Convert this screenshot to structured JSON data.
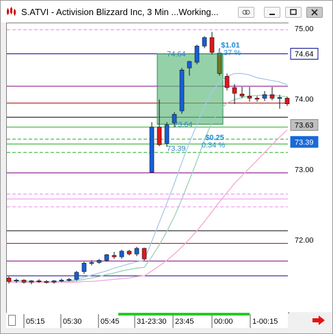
{
  "window": {
    "title": "S.ATVI - Activision Blizzard Inc, 3 Min ...Working...",
    "buttons": [
      "link-icon",
      "minimize-icon",
      "restore-icon",
      "close-icon"
    ]
  },
  "chart_data": {
    "type": "candlestick",
    "title": "",
    "ylim": [
      71.3,
      75.1
    ],
    "y_ticks": [
      75.0,
      74.0,
      73.0,
      72.0
    ],
    "y_tick_labels": [
      "75.00",
      "74.00",
      "73.00",
      "72.00"
    ],
    "x_tick_labels": [
      "05:15",
      "05:30",
      "05:45",
      "31-23:30",
      "23:45",
      "00:00",
      "1-00:15"
    ],
    "price_badges": [
      {
        "value": 74.64,
        "label": "74.64",
        "style": "outline"
      },
      {
        "value": 73.63,
        "label": "73.63",
        "style": "gray"
      },
      {
        "value": 73.39,
        "label": "73.39",
        "style": "blue"
      }
    ],
    "candles": [
      {
        "o": 71.46,
        "h": 71.48,
        "l": 71.38,
        "c": 71.41
      },
      {
        "o": 71.42,
        "h": 71.45,
        "l": 71.39,
        "c": 71.43
      },
      {
        "o": 71.43,
        "h": 71.44,
        "l": 71.38,
        "c": 71.4
      },
      {
        "o": 71.4,
        "h": 71.43,
        "l": 71.37,
        "c": 71.42
      },
      {
        "o": 71.42,
        "h": 71.44,
        "l": 71.39,
        "c": 71.41
      },
      {
        "o": 71.41,
        "h": 71.43,
        "l": 71.38,
        "c": 71.4
      },
      {
        "o": 71.4,
        "h": 71.43,
        "l": 71.38,
        "c": 71.42
      },
      {
        "o": 71.42,
        "h": 71.45,
        "l": 71.4,
        "c": 71.43
      },
      {
        "o": 71.43,
        "h": 71.46,
        "l": 71.41,
        "c": 71.44
      },
      {
        "o": 71.44,
        "h": 71.56,
        "l": 71.42,
        "c": 71.54
      },
      {
        "o": 71.55,
        "h": 71.69,
        "l": 71.52,
        "c": 71.67
      },
      {
        "o": 71.67,
        "h": 71.71,
        "l": 71.64,
        "c": 71.68
      },
      {
        "o": 71.68,
        "h": 71.73,
        "l": 71.66,
        "c": 71.71
      },
      {
        "o": 71.71,
        "h": 71.8,
        "l": 71.69,
        "c": 71.79
      },
      {
        "o": 71.78,
        "h": 71.83,
        "l": 71.73,
        "c": 71.76
      },
      {
        "o": 71.76,
        "h": 71.86,
        "l": 71.73,
        "c": 71.84
      },
      {
        "o": 71.84,
        "h": 71.86,
        "l": 71.78,
        "c": 71.8
      },
      {
        "o": 71.8,
        "h": 71.9,
        "l": 71.77,
        "c": 71.88
      },
      {
        "o": 71.88,
        "h": 71.89,
        "l": 71.71,
        "c": 71.73
      },
      {
        "o": 72.96,
        "h": 73.67,
        "l": 72.96,
        "c": 73.6
      },
      {
        "o": 73.6,
        "h": 73.99,
        "l": 73.33,
        "c": 73.35
      },
      {
        "o": 73.37,
        "h": 73.67,
        "l": 73.32,
        "c": 73.63
      },
      {
        "o": 73.66,
        "h": 73.81,
        "l": 73.6,
        "c": 73.78
      },
      {
        "o": 73.83,
        "h": 74.44,
        "l": 73.79,
        "c": 74.41
      },
      {
        "o": 74.44,
        "h": 74.54,
        "l": 74.33,
        "c": 74.53
      },
      {
        "o": 74.52,
        "h": 74.77,
        "l": 74.49,
        "c": 74.75
      },
      {
        "o": 74.75,
        "h": 74.89,
        "l": 74.72,
        "c": 74.87
      },
      {
        "o": 74.87,
        "h": 74.95,
        "l": 74.63,
        "c": 74.66
      },
      {
        "o": 74.65,
        "h": 74.72,
        "l": 74.33,
        "c": 74.36
      },
      {
        "o": 74.32,
        "h": 74.36,
        "l": 74.12,
        "c": 74.16
      },
      {
        "o": 74.16,
        "h": 74.21,
        "l": 73.93,
        "c": 74.08
      },
      {
        "o": 74.07,
        "h": 74.17,
        "l": 74.01,
        "c": 74.04
      },
      {
        "o": 74.04,
        "h": 74.17,
        "l": 73.96,
        "c": 74.01
      },
      {
        "o": 74.01,
        "h": 74.04,
        "l": 73.96,
        "c": 74.0
      },
      {
        "o": 74.01,
        "h": 74.11,
        "l": 73.97,
        "c": 74.06
      },
      {
        "o": 74.06,
        "h": 74.17,
        "l": 73.98,
        "c": 74.01
      },
      {
        "o": 74.01,
        "h": 74.06,
        "l": 73.86,
        "c": 74.02
      },
      {
        "o": 74.01,
        "h": 74.03,
        "l": 73.9,
        "c": 73.93
      }
    ],
    "horizontal_lines": [
      {
        "value": 74.98,
        "color": "#ee88ee",
        "style": "dashed"
      },
      {
        "value": 74.64,
        "color": "#00008b",
        "style": "solid"
      },
      {
        "value": 74.18,
        "color": "#800080",
        "style": "solid"
      },
      {
        "value": 73.94,
        "color": "#aa0000",
        "style": "solid"
      },
      {
        "value": 73.74,
        "color": "#000000",
        "style": "solid"
      },
      {
        "value": 73.6,
        "color": "#22aa22",
        "style": "solid"
      },
      {
        "value": 73.43,
        "color": "#22aa22",
        "style": "dashed"
      },
      {
        "value": 73.36,
        "color": "#22aa22",
        "style": "solid"
      },
      {
        "value": 73.24,
        "color": "#22aa22",
        "style": "dashed"
      },
      {
        "value": 72.95,
        "color": "#800080",
        "style": "solid"
      },
      {
        "value": 72.65,
        "color": "#ee88ee",
        "style": "dashed"
      },
      {
        "value": 72.58,
        "color": "#ee88ee",
        "style": "solid"
      },
      {
        "value": 72.47,
        "color": "#ee88ee",
        "style": "dashed"
      },
      {
        "value": 72.13,
        "color": "#000000",
        "style": "solid"
      },
      {
        "value": 71.95,
        "color": "#aa0000",
        "style": "solid"
      },
      {
        "value": 71.7,
        "color": "#800080",
        "style": "solid"
      },
      {
        "value": 71.49,
        "color": "#00008b",
        "style": "solid"
      }
    ],
    "moving_averages": [
      {
        "color": "#a6c8e8",
        "values": [
          71.4,
          71.4,
          71.4,
          71.4,
          71.4,
          71.4,
          71.41,
          71.41,
          71.42,
          71.44,
          71.47,
          71.5,
          71.53,
          71.56,
          71.6,
          71.63,
          71.66,
          71.69,
          71.71,
          71.98,
          72.25,
          72.52,
          72.8,
          73.1,
          73.38,
          73.64,
          73.9,
          74.1,
          74.24,
          74.32,
          74.36,
          74.36,
          74.34,
          74.3,
          74.28,
          74.26,
          74.24,
          74.2
        ]
      },
      {
        "color": "#9ad0b8",
        "values": [
          71.42,
          71.42,
          71.42,
          71.41,
          71.41,
          71.41,
          71.41,
          71.41,
          71.41,
          71.42,
          71.44,
          71.46,
          71.48,
          71.51,
          71.53,
          71.56,
          71.58,
          71.6,
          71.61,
          71.76,
          71.93,
          72.12,
          72.33,
          72.58,
          72.85,
          73.12,
          73.42,
          73.67,
          73.84,
          73.94,
          73.99,
          74.02,
          74.04,
          74.05,
          74.05,
          74.05,
          74.04,
          74.03
        ]
      },
      {
        "color": "#f4a6d0",
        "values": [
          71.4,
          71.4,
          71.4,
          71.4,
          71.4,
          71.4,
          71.4,
          71.4,
          71.4,
          71.4,
          71.41,
          71.41,
          71.42,
          71.43,
          71.44,
          71.45,
          71.46,
          71.48,
          71.49,
          71.56,
          71.63,
          71.71,
          71.8,
          71.9,
          72.01,
          72.13,
          72.26,
          72.4,
          72.54,
          72.67,
          72.8,
          72.91,
          73.02,
          73.13,
          73.24,
          73.35,
          73.46,
          73.56
        ]
      }
    ],
    "trade_box": {
      "entry": 73.64,
      "exit": 74.64,
      "start_index": 21,
      "end_index": 28
    },
    "annotations": [
      {
        "text": "$1.01",
        "sub": "1.37 %",
        "value": 74.64
      },
      {
        "text": "$0.25",
        "sub": "0.34 %",
        "value": 73.39
      }
    ],
    "box_labels": [
      "74.64",
      "73.64",
      "73.39"
    ],
    "grid": false,
    "session_bar": {
      "color": "#22cc22"
    }
  }
}
